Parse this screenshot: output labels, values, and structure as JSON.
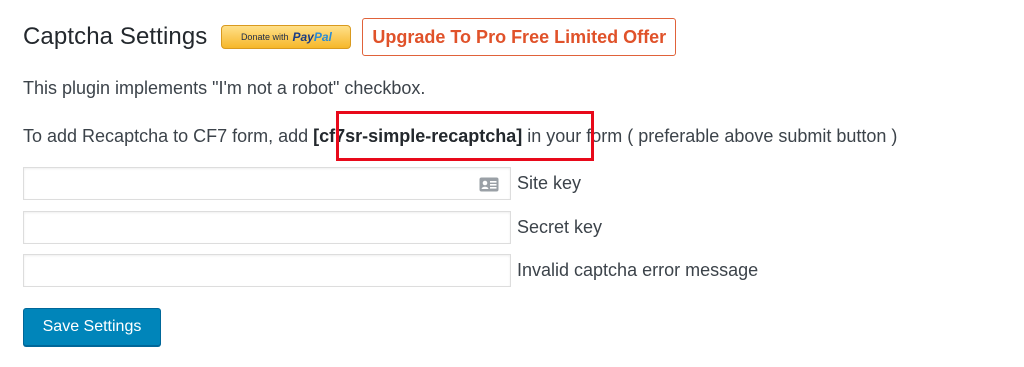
{
  "header": {
    "title": "Captcha Settings",
    "paypal": {
      "donate_text": "Donate with",
      "brand_pay": "Pay",
      "brand_pal": "Pal"
    },
    "upgrade_label": "Upgrade To Pro Free Limited Offer"
  },
  "description": {
    "line1": "This plugin implements \"I'm not a robot\" checkbox.",
    "line2_before": "To add Recaptcha to CF7 form, add ",
    "shortcode": "[cf7sr-simple-recaptcha]",
    "line2_after": " in your form ( preferable above submit button )"
  },
  "fields": [
    {
      "label": "Site key",
      "value": "",
      "icon": "contact-card-icon"
    },
    {
      "label": "Secret key",
      "value": ""
    },
    {
      "label": "Invalid captcha error message",
      "value": ""
    }
  ],
  "save_label": "Save Settings",
  "colors": {
    "accent": "#0085ba",
    "upgrade": "#e0522a",
    "highlight": "#e8091a",
    "paypal_gold": "#f6b72a"
  }
}
